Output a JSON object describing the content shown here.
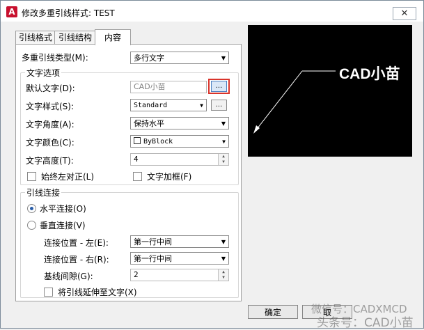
{
  "window": {
    "title": "修改多重引线样式: TEST",
    "close_glyph": "✕",
    "app_icon": "A"
  },
  "tabs": [
    {
      "label": "引线格式",
      "active": false
    },
    {
      "label": "引线结构",
      "active": false
    },
    {
      "label": "内容",
      "active": true
    }
  ],
  "content": {
    "leader_type_label": "多重引线类型(M):",
    "leader_type_value": "多行文字",
    "text_options_title": "文字选项",
    "default_text_label": "默认文字(D):",
    "default_text_value": "CAD小苗",
    "browse_label": "...",
    "text_style_label": "文字样式(S):",
    "text_style_value": "Standard",
    "text_angle_label": "文字角度(A):",
    "text_angle_value": "保持水平",
    "text_color_label": "文字颜色(C):",
    "text_color_value": "ByBlock",
    "text_height_label": "文字高度(T):",
    "text_height_value": "4",
    "always_left_label": "始终左对正(L)",
    "text_frame_label": "文字加框(F)",
    "leader_connection_title": "引线连接",
    "horizontal_label": "水平连接(O)",
    "vertical_label": "垂直连接(V)",
    "attach_left_label": "连接位置 - 左(E):",
    "attach_left_value": "第一行中间",
    "attach_right_label": "连接位置 - 右(R):",
    "attach_right_value": "第一行中间",
    "landing_gap_label": "基线间隙(G):",
    "landing_gap_value": "2",
    "extend_leader_label": "将引线延伸至文字(X)"
  },
  "preview": {
    "text": "CAD小苗"
  },
  "buttons": {
    "ok": "确定",
    "cancel": "取"
  },
  "watermark": {
    "line1": "微信号：CADXMCD",
    "line2": "头条号：CAD小苗"
  },
  "colors": {
    "highlight_border": "#d9342b",
    "preview_bg": "#000000",
    "radio_dot": "#2a5ea8"
  }
}
